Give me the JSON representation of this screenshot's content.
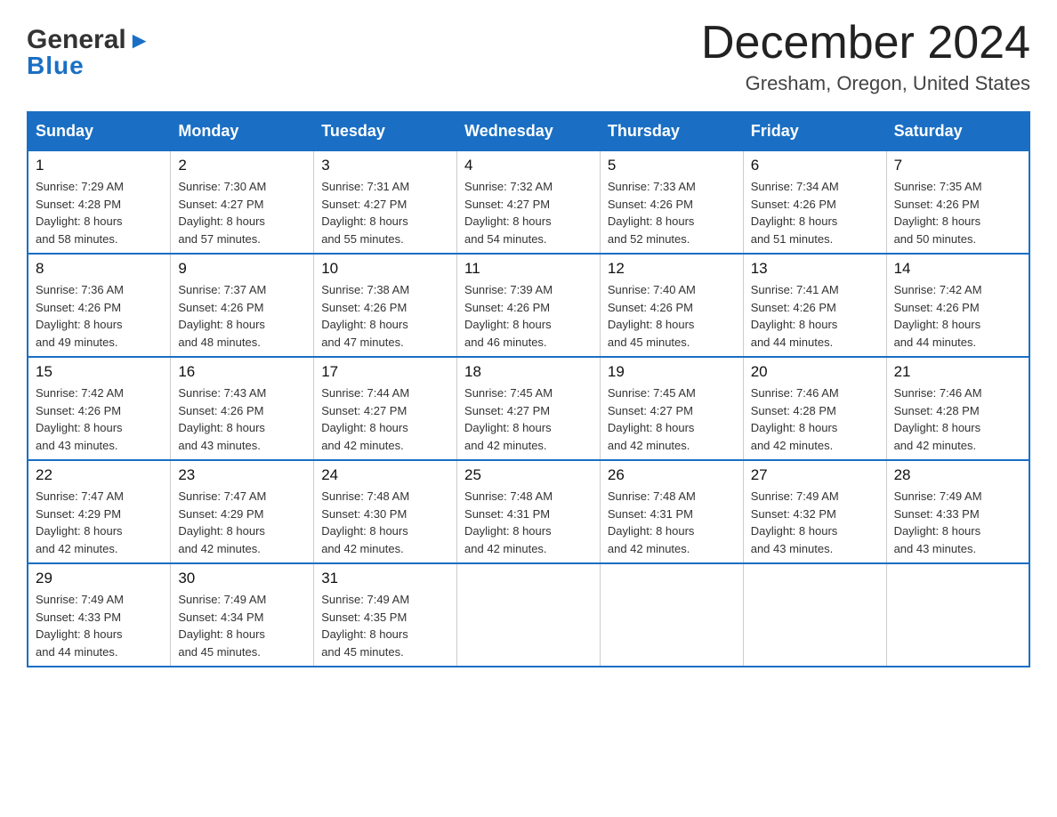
{
  "header": {
    "logo_general": "General",
    "logo_blue": "Blue",
    "month_title": "December 2024",
    "location": "Gresham, Oregon, United States"
  },
  "weekdays": [
    "Sunday",
    "Monday",
    "Tuesday",
    "Wednesday",
    "Thursday",
    "Friday",
    "Saturday"
  ],
  "weeks": [
    [
      {
        "day": "1",
        "sunrise": "7:29 AM",
        "sunset": "4:28 PM",
        "daylight": "8 hours and 58 minutes."
      },
      {
        "day": "2",
        "sunrise": "7:30 AM",
        "sunset": "4:27 PM",
        "daylight": "8 hours and 57 minutes."
      },
      {
        "day": "3",
        "sunrise": "7:31 AM",
        "sunset": "4:27 PM",
        "daylight": "8 hours and 55 minutes."
      },
      {
        "day": "4",
        "sunrise": "7:32 AM",
        "sunset": "4:27 PM",
        "daylight": "8 hours and 54 minutes."
      },
      {
        "day": "5",
        "sunrise": "7:33 AM",
        "sunset": "4:26 PM",
        "daylight": "8 hours and 52 minutes."
      },
      {
        "day": "6",
        "sunrise": "7:34 AM",
        "sunset": "4:26 PM",
        "daylight": "8 hours and 51 minutes."
      },
      {
        "day": "7",
        "sunrise": "7:35 AM",
        "sunset": "4:26 PM",
        "daylight": "8 hours and 50 minutes."
      }
    ],
    [
      {
        "day": "8",
        "sunrise": "7:36 AM",
        "sunset": "4:26 PM",
        "daylight": "8 hours and 49 minutes."
      },
      {
        "day": "9",
        "sunrise": "7:37 AM",
        "sunset": "4:26 PM",
        "daylight": "8 hours and 48 minutes."
      },
      {
        "day": "10",
        "sunrise": "7:38 AM",
        "sunset": "4:26 PM",
        "daylight": "8 hours and 47 minutes."
      },
      {
        "day": "11",
        "sunrise": "7:39 AM",
        "sunset": "4:26 PM",
        "daylight": "8 hours and 46 minutes."
      },
      {
        "day": "12",
        "sunrise": "7:40 AM",
        "sunset": "4:26 PM",
        "daylight": "8 hours and 45 minutes."
      },
      {
        "day": "13",
        "sunrise": "7:41 AM",
        "sunset": "4:26 PM",
        "daylight": "8 hours and 44 minutes."
      },
      {
        "day": "14",
        "sunrise": "7:42 AM",
        "sunset": "4:26 PM",
        "daylight": "8 hours and 44 minutes."
      }
    ],
    [
      {
        "day": "15",
        "sunrise": "7:42 AM",
        "sunset": "4:26 PM",
        "daylight": "8 hours and 43 minutes."
      },
      {
        "day": "16",
        "sunrise": "7:43 AM",
        "sunset": "4:26 PM",
        "daylight": "8 hours and 43 minutes."
      },
      {
        "day": "17",
        "sunrise": "7:44 AM",
        "sunset": "4:27 PM",
        "daylight": "8 hours and 42 minutes."
      },
      {
        "day": "18",
        "sunrise": "7:45 AM",
        "sunset": "4:27 PM",
        "daylight": "8 hours and 42 minutes."
      },
      {
        "day": "19",
        "sunrise": "7:45 AM",
        "sunset": "4:27 PM",
        "daylight": "8 hours and 42 minutes."
      },
      {
        "day": "20",
        "sunrise": "7:46 AM",
        "sunset": "4:28 PM",
        "daylight": "8 hours and 42 minutes."
      },
      {
        "day": "21",
        "sunrise": "7:46 AM",
        "sunset": "4:28 PM",
        "daylight": "8 hours and 42 minutes."
      }
    ],
    [
      {
        "day": "22",
        "sunrise": "7:47 AM",
        "sunset": "4:29 PM",
        "daylight": "8 hours and 42 minutes."
      },
      {
        "day": "23",
        "sunrise": "7:47 AM",
        "sunset": "4:29 PM",
        "daylight": "8 hours and 42 minutes."
      },
      {
        "day": "24",
        "sunrise": "7:48 AM",
        "sunset": "4:30 PM",
        "daylight": "8 hours and 42 minutes."
      },
      {
        "day": "25",
        "sunrise": "7:48 AM",
        "sunset": "4:31 PM",
        "daylight": "8 hours and 42 minutes."
      },
      {
        "day": "26",
        "sunrise": "7:48 AM",
        "sunset": "4:31 PM",
        "daylight": "8 hours and 42 minutes."
      },
      {
        "day": "27",
        "sunrise": "7:49 AM",
        "sunset": "4:32 PM",
        "daylight": "8 hours and 43 minutes."
      },
      {
        "day": "28",
        "sunrise": "7:49 AM",
        "sunset": "4:33 PM",
        "daylight": "8 hours and 43 minutes."
      }
    ],
    [
      {
        "day": "29",
        "sunrise": "7:49 AM",
        "sunset": "4:33 PM",
        "daylight": "8 hours and 44 minutes."
      },
      {
        "day": "30",
        "sunrise": "7:49 AM",
        "sunset": "4:34 PM",
        "daylight": "8 hours and 45 minutes."
      },
      {
        "day": "31",
        "sunrise": "7:49 AM",
        "sunset": "4:35 PM",
        "daylight": "8 hours and 45 minutes."
      },
      null,
      null,
      null,
      null
    ]
  ],
  "labels": {
    "sunrise": "Sunrise:",
    "sunset": "Sunset:",
    "daylight": "Daylight:"
  }
}
